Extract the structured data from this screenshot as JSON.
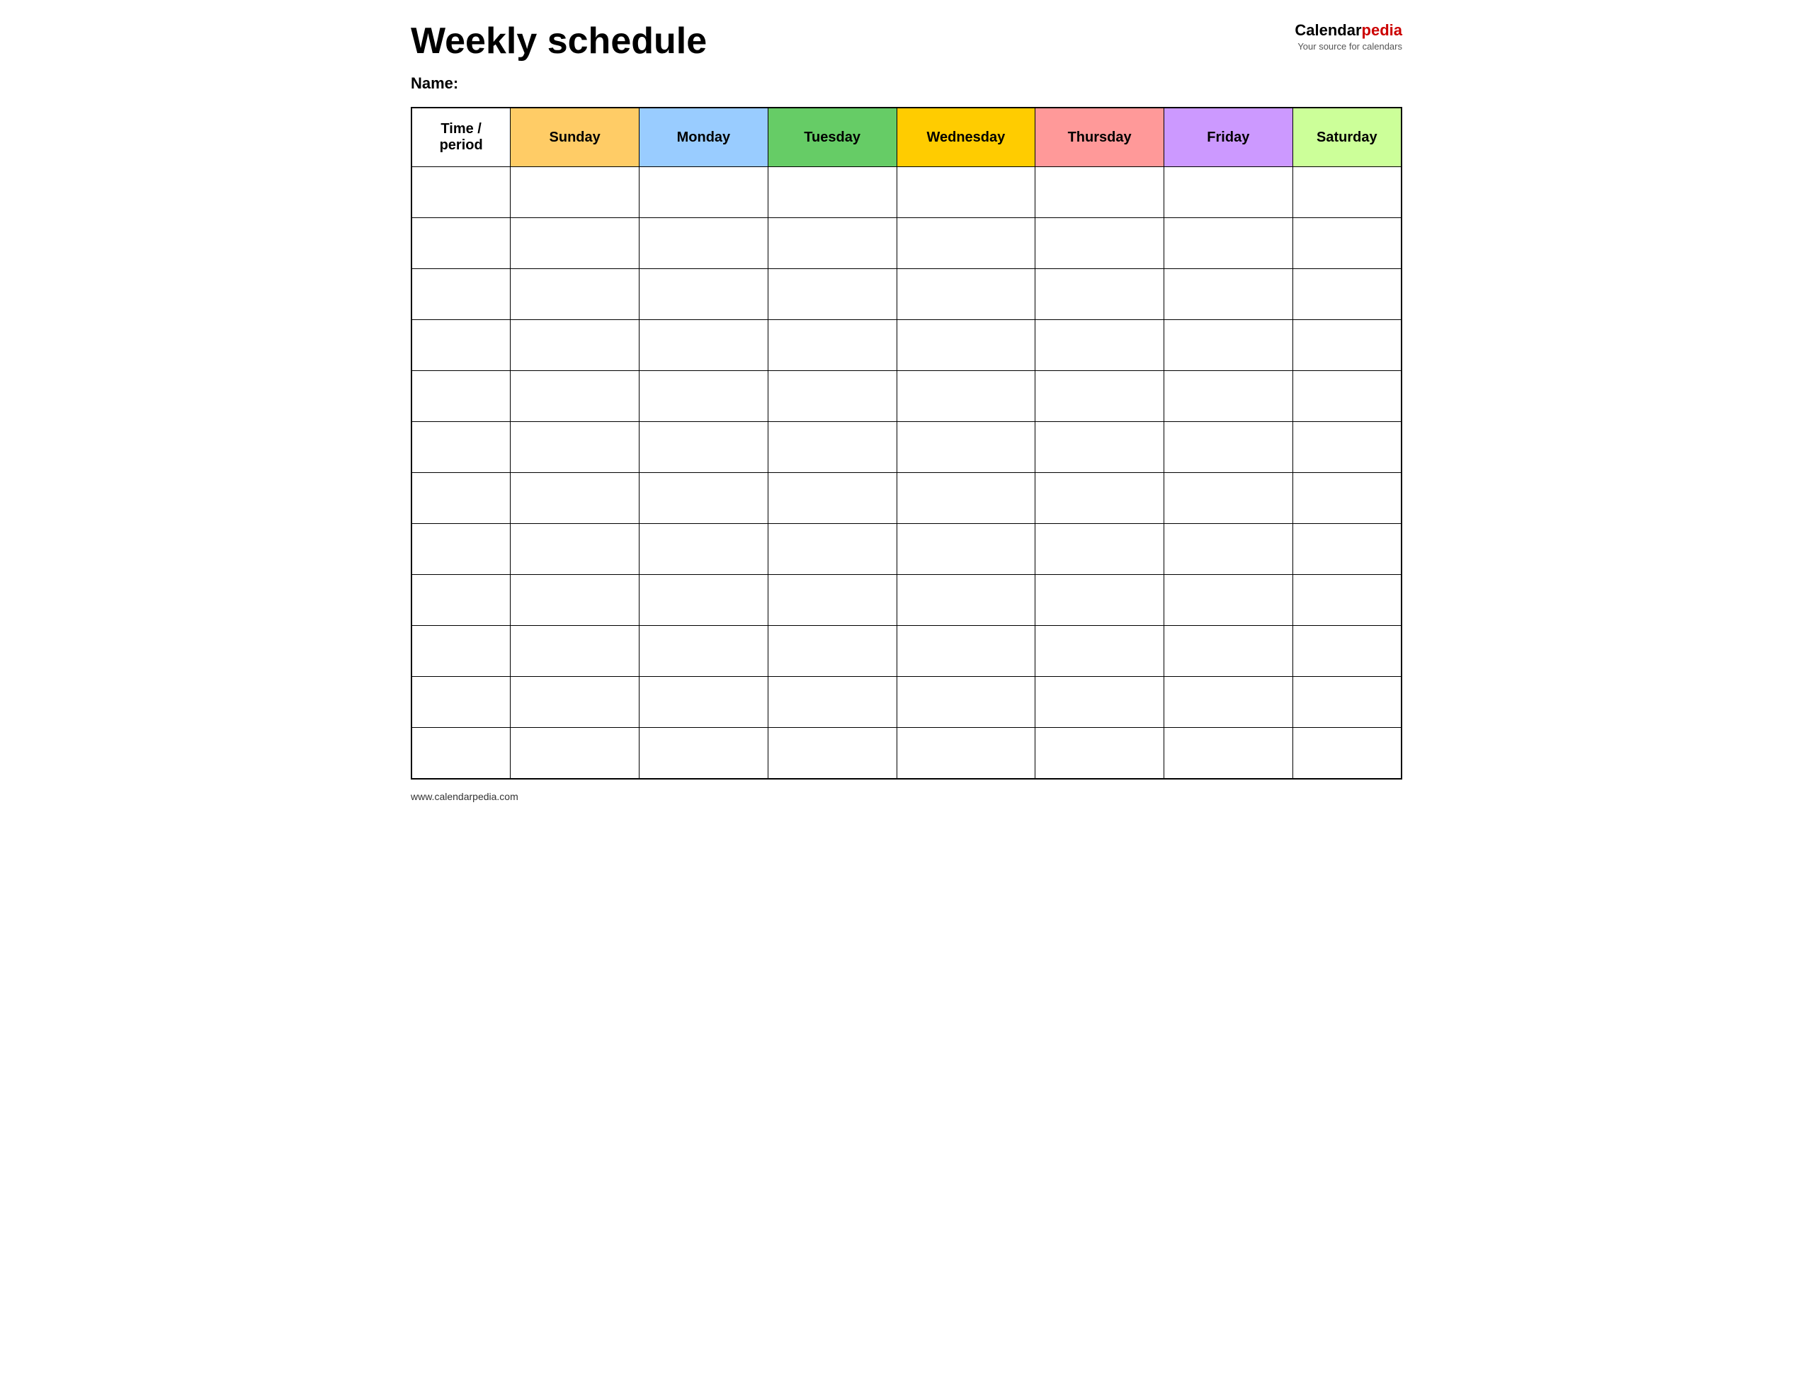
{
  "page": {
    "title": "Weekly schedule",
    "name_label": "Name:",
    "footer_url": "www.calendarpedia.com"
  },
  "logo": {
    "brand": "Calendar",
    "brand_accent": "pedia",
    "subtitle": "Your source for calendars"
  },
  "table": {
    "headers": [
      {
        "id": "time",
        "label": "Time / period",
        "color_class": "col-time"
      },
      {
        "id": "sunday",
        "label": "Sunday",
        "color_class": "col-sunday"
      },
      {
        "id": "monday",
        "label": "Monday",
        "color_class": "col-monday"
      },
      {
        "id": "tuesday",
        "label": "Tuesday",
        "color_class": "col-tuesday"
      },
      {
        "id": "wednesday",
        "label": "Wednesday",
        "color_class": "col-wednesday"
      },
      {
        "id": "thursday",
        "label": "Thursday",
        "color_class": "col-thursday"
      },
      {
        "id": "friday",
        "label": "Friday",
        "color_class": "col-friday"
      },
      {
        "id": "saturday",
        "label": "Saturday",
        "color_class": "col-saturday"
      }
    ],
    "row_count": 12
  }
}
